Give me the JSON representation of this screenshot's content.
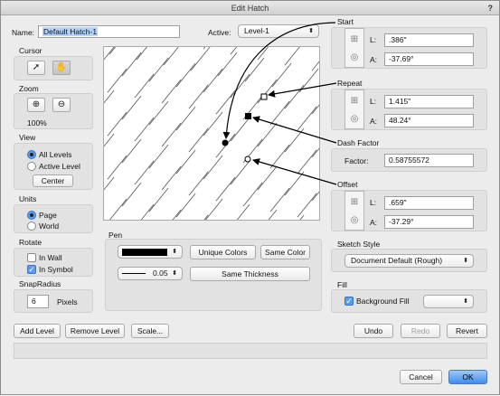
{
  "window": {
    "title": "Edit Hatch",
    "help": "?"
  },
  "name_label": "Name:",
  "name_value": "Default Hatch-1",
  "active_label": "Active:",
  "active_value": "Level-1",
  "cursor": {
    "title": "Cursor"
  },
  "zoom": {
    "title": "Zoom",
    "value": "100%"
  },
  "view": {
    "title": "View",
    "all_levels": "All Levels",
    "active_level": "Active Level",
    "center": "Center"
  },
  "units": {
    "title": "Units",
    "page": "Page",
    "world": "World"
  },
  "rotate": {
    "title": "Rotate",
    "in_wall": "In Wall",
    "in_symbol": "In Symbol"
  },
  "snap": {
    "title": "SnapRadius",
    "value": "6",
    "unit": "Pixels"
  },
  "pen": {
    "title": "Pen",
    "weight": "0.05",
    "unique_colors": "Unique Colors",
    "same_color": "Same Color",
    "same_thickness": "Same Thickness"
  },
  "start": {
    "title": "Start",
    "l_label": "L:",
    "l_value": ".386\"",
    "a_label": "A:",
    "a_value": "-37.69°"
  },
  "repeat": {
    "title": "Repeat",
    "l_label": "L:",
    "l_value": "1.415\"",
    "a_label": "A:",
    "a_value": "48.24°"
  },
  "dash": {
    "title": "Dash Factor",
    "label": "Factor:",
    "value": "0.58755572"
  },
  "offset": {
    "title": "Offset",
    "l_label": "L:",
    "l_value": ".659\"",
    "a_label": "A:",
    "a_value": "-37.29°"
  },
  "sketch": {
    "title": "Sketch Style",
    "value": "Document Default (Rough)"
  },
  "fill": {
    "title": "Fill",
    "background_fill": "Background Fill"
  },
  "bottom": {
    "add_level": "Add Level",
    "remove_level": "Remove Level",
    "scale": "Scale...",
    "undo": "Undo",
    "redo": "Redo",
    "revert": "Revert",
    "cancel": "Cancel",
    "ok": "OK"
  },
  "colors": {
    "ok_button": "#3d8ef0",
    "selection": "#b3d4fc",
    "check_accent": "#5d9cec"
  },
  "icons": {
    "cursor_tools": [
      "arrow-cursor-icon",
      "hand-cursor-icon"
    ],
    "zoom_tools": [
      "zoom-in-icon",
      "zoom-out-icon"
    ]
  }
}
